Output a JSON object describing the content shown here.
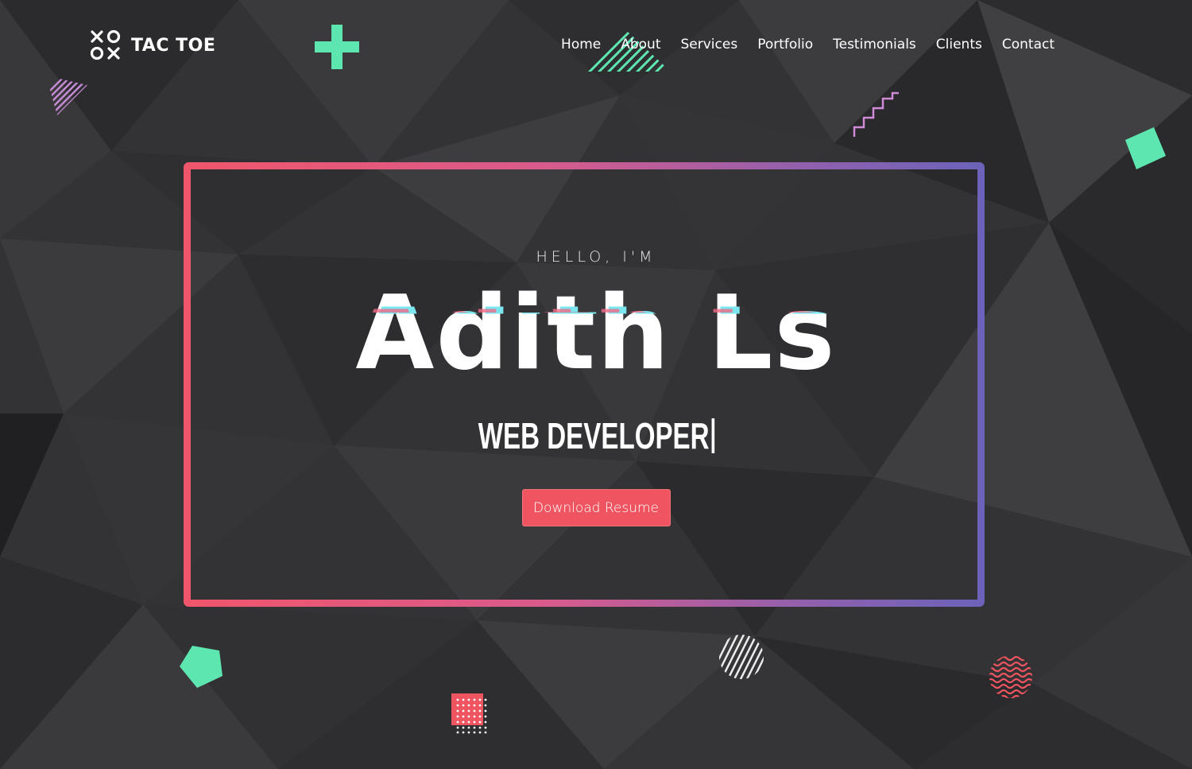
{
  "brand": {
    "logo_text": "TAC TOE",
    "logo_icon": "xo-grid-icon"
  },
  "nav": {
    "items": [
      {
        "label": "Home"
      },
      {
        "label": "About"
      },
      {
        "label": "Services"
      },
      {
        "label": "Portfolio"
      },
      {
        "label": "Testimonials"
      },
      {
        "label": "Clients"
      },
      {
        "label": "Contact"
      }
    ]
  },
  "hero": {
    "greeting": "HELLO, I'M",
    "name": "Adith Ls",
    "role": "WEB DEVELOPER",
    "cta_label": "Download Resume"
  },
  "colors": {
    "accent_green": "#5ee6b1",
    "accent_red": "#ef5560",
    "accent_pink": "#f0566b",
    "accent_purple": "#6e62b8",
    "background": "#303032"
  }
}
